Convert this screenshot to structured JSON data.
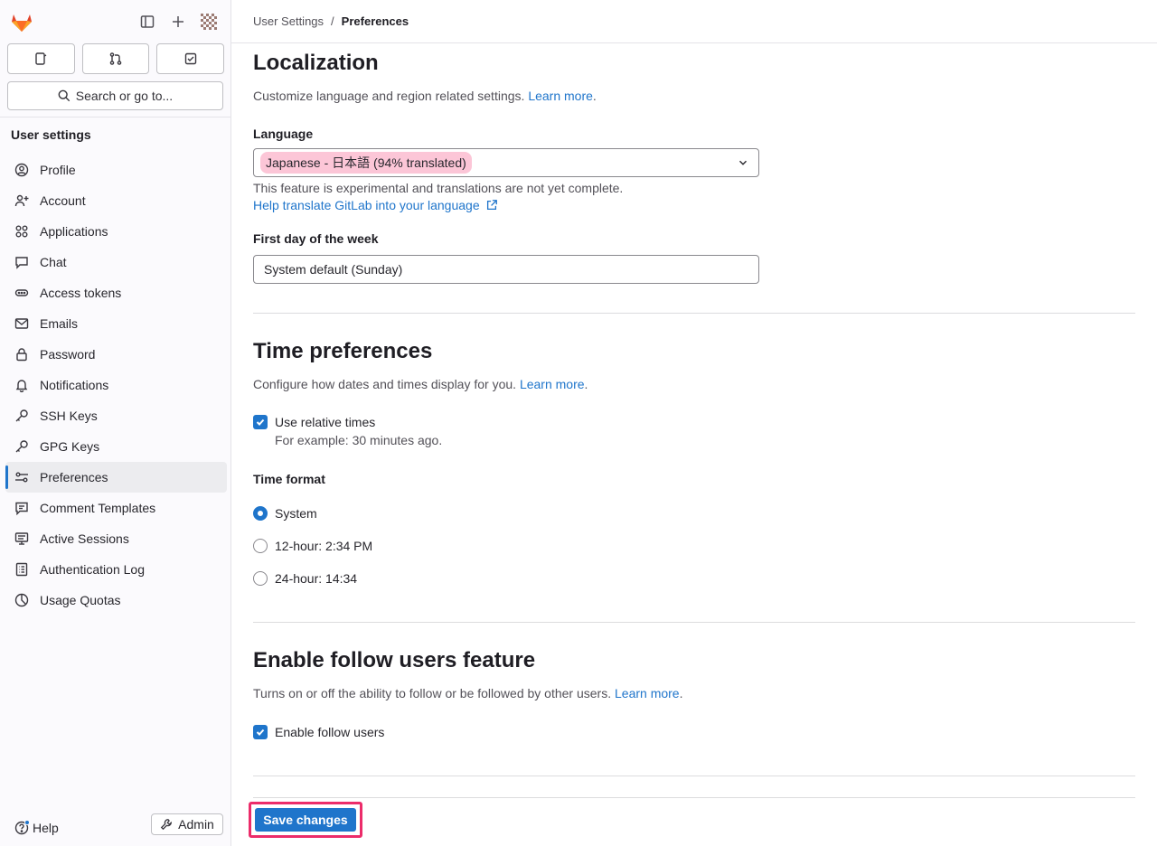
{
  "breadcrumb": {
    "parent": "User Settings",
    "separator": "/",
    "current": "Preferences"
  },
  "sidebar": {
    "search_label": "Search or go to...",
    "section_title": "User settings",
    "items": [
      {
        "label": "Profile",
        "icon": "profile-icon"
      },
      {
        "label": "Account",
        "icon": "account-icon"
      },
      {
        "label": "Applications",
        "icon": "applications-icon"
      },
      {
        "label": "Chat",
        "icon": "chat-icon"
      },
      {
        "label": "Access tokens",
        "icon": "token-icon"
      },
      {
        "label": "Emails",
        "icon": "mail-icon"
      },
      {
        "label": "Password",
        "icon": "lock-icon"
      },
      {
        "label": "Notifications",
        "icon": "bell-icon"
      },
      {
        "label": "SSH Keys",
        "icon": "key-icon"
      },
      {
        "label": "GPG Keys",
        "icon": "key-icon"
      },
      {
        "label": "Preferences",
        "icon": "preferences-icon",
        "active": true
      },
      {
        "label": "Comment Templates",
        "icon": "comment-icon"
      },
      {
        "label": "Active Sessions",
        "icon": "monitor-icon"
      },
      {
        "label": "Authentication Log",
        "icon": "log-icon"
      },
      {
        "label": "Usage Quotas",
        "icon": "quota-icon"
      }
    ],
    "help_label": "Help",
    "admin_label": "Admin"
  },
  "localization": {
    "title": "Localization",
    "desc": "Customize language and region related settings.",
    "learn_more": "Learn more",
    "language_label": "Language",
    "language_value": "Japanese - 日本語 (94% translated)",
    "experimental_note": "This feature is experimental and translations are not yet complete.",
    "help_translate": "Help translate GitLab into your language",
    "first_day_label": "First day of the week",
    "first_day_value": "System default (Sunday)"
  },
  "time_preferences": {
    "title": "Time preferences",
    "desc": "Configure how dates and times display for you.",
    "learn_more": "Learn more",
    "relative_label": "Use relative times",
    "relative_example": "For example: 30 minutes ago.",
    "time_format_label": "Time format",
    "options": [
      "System",
      "12-hour: 2:34 PM",
      "24-hour: 14:34"
    ],
    "selected": "System"
  },
  "follow": {
    "title": "Enable follow users feature",
    "desc": "Turns on or off the ability to follow or be followed by other users.",
    "learn_more": "Learn more",
    "checkbox_label": "Enable follow users"
  },
  "save_label": "Save changes",
  "colors": {
    "accent": "#1f75cb",
    "highlight": "#fcc6d7",
    "save_outline": "#ec2c6a"
  }
}
